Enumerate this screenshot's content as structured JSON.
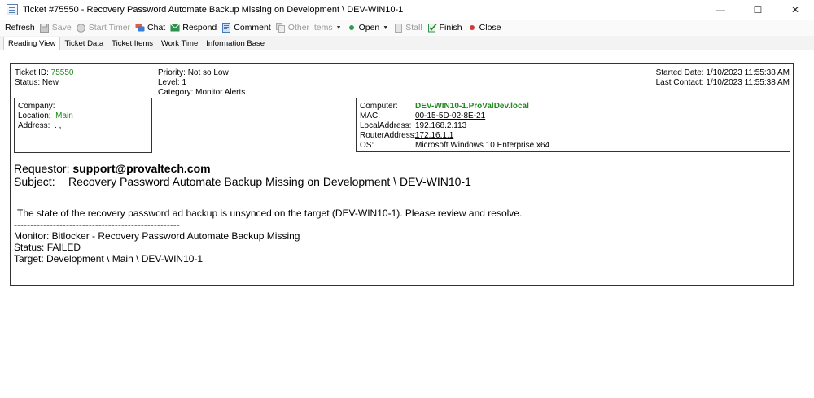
{
  "window": {
    "title": "Ticket #75550 - Recovery Password Automate Backup Missing on Development \\ DEV-WIN10-1",
    "minimize": "—",
    "maximize": "☐",
    "close": "✕"
  },
  "toolbar": {
    "refresh": "Refresh",
    "save": "Save",
    "start_timer": "Start Timer",
    "chat": "Chat",
    "respond": "Respond",
    "comment": "Comment",
    "other_items": "Other Items",
    "open": "Open",
    "stall": "Stall",
    "finish": "Finish",
    "close": "Close"
  },
  "tabs": [
    {
      "label": "Reading View",
      "active": true
    },
    {
      "label": "Ticket Data"
    },
    {
      "label": "Ticket Items"
    },
    {
      "label": "Work Time"
    },
    {
      "label": "Information Base"
    }
  ],
  "ticket": {
    "id_label": "Ticket ID:",
    "id": "75550",
    "status_label": "Status:",
    "status": "New",
    "priority_label": "Priority:",
    "priority": "Not so Low",
    "level_label": "Level:",
    "level": "1",
    "category_label": "Category:",
    "category": "Monitor Alerts",
    "started_label": "Started Date:",
    "started": "1/10/2023 11:55:38 AM",
    "last_contact_label": "Last Contact:",
    "last_contact": "1/10/2023 11:55:38 AM"
  },
  "company": {
    "company_label": "Company:",
    "company": "",
    "location_label": "Location:",
    "location": "Main",
    "address_label": "Address:",
    "address": ". ,"
  },
  "computer": {
    "computer_label": "Computer:",
    "computer": "DEV-WIN10-1.ProValDev.local",
    "mac_label": "MAC:",
    "mac": "00-15-5D-02-8E-21",
    "local_label": "LocalAddress:",
    "local": "192.168.2.113",
    "router_label": "RouterAddress:",
    "router": "172.16.1.1",
    "os_label": "OS:",
    "os": "Microsoft Windows 10 Enterprise x64"
  },
  "message": {
    "requestor_label": "Requestor:",
    "requestor": "support@provaltech.com",
    "subject_label": "Subject:",
    "subject": "Recovery Password Automate Backup Missing on Development \\ DEV-WIN10-1",
    "body": "The state of the recovery password ad backup is unsynced on the target (DEV-WIN10-1). Please review and resolve.",
    "divider": "---------------------------------------------------",
    "monitor": "Monitor: Bitlocker - Recovery Password Automate Backup Missing",
    "status": "Status: FAILED",
    "target": "Target: Development \\ Main \\ DEV-WIN10-1"
  },
  "colors": {
    "accent_green": "#1f8a1f",
    "close_red": "#d23a3a"
  }
}
